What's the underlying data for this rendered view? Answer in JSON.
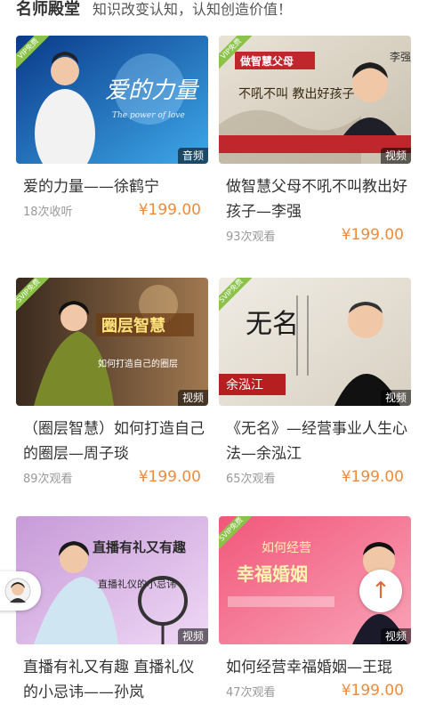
{
  "header": {
    "title": "名师殿堂",
    "slogan": "知识改变认知，认知创造价值！"
  },
  "cards": [
    {
      "title": "爱的力量——徐鹤宁",
      "views": "18次收听",
      "price": "¥199.00",
      "type": "音频",
      "vip": "VIP免费",
      "thumb_text": "爱的力量",
      "thumb_sub": "The power of love",
      "bg1": "#0a3a8a",
      "bg2": "#3ea8e8"
    },
    {
      "title": "做智慧父母不吼不叫教出好孩子—李强",
      "views": "93次观看",
      "price": "¥199.00",
      "type": "视频",
      "vip": "VIP免费",
      "thumb_text": "做智慧父母",
      "thumb_sub": "不吼不叫 教出好孩子",
      "thumb_name": "李强",
      "bg1": "#e9e3d6",
      "bg2": "#c8bfae"
    },
    {
      "title": "（圈层智慧）如何打造自己的圈层—周子琰",
      "views": "89次观看",
      "price": "¥199.00",
      "type": "视频",
      "vip": "SVIP免费",
      "thumb_text": "圈层智慧",
      "thumb_sub": "如何打造自己的圈层",
      "bg1": "#3a2a1e",
      "bg2": "#a07850"
    },
    {
      "title": "《无名》—经营事业人生心法—余泓江",
      "views": "65次观看",
      "price": "¥199.00",
      "type": "视频",
      "vip": "SVIP免费",
      "thumb_text": "无名",
      "thumb_name": "余泓江",
      "bg1": "#f0ece4",
      "bg2": "#d8d0c2"
    },
    {
      "title": "直播有礼又有趣 直播礼仪的小忌讳——孙岚",
      "views": "",
      "price": "",
      "type": "视频",
      "vip": "",
      "thumb_text": "直播有礼又有趣",
      "thumb_sub": "直播礼仪的小忌讳",
      "bg1": "#c79ad8",
      "bg2": "#efd8f5"
    },
    {
      "title": "如何经营幸福婚姻—王琨",
      "views": "47次观看",
      "price": "¥199.00",
      "type": "视频",
      "vip": "SVIP免费",
      "thumb_text": "如何经营",
      "thumb_sub": "幸福婚姻",
      "bg1": "#f1577a",
      "bg2": "#f9a3b8"
    }
  ],
  "ui": {
    "back_to_top": "↑"
  }
}
